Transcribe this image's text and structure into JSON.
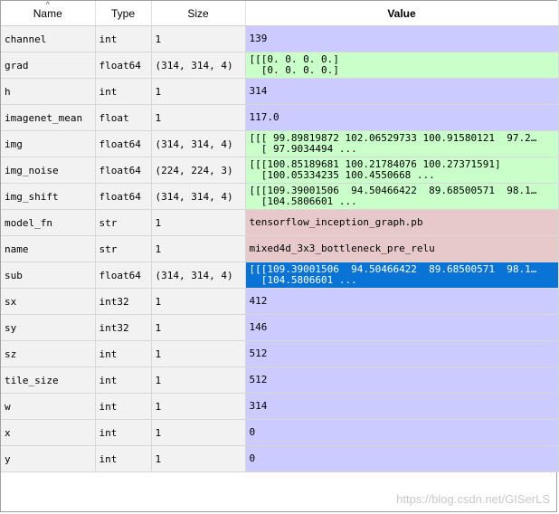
{
  "header": {
    "sort_indicator": "^",
    "name": "Name",
    "type": "Type",
    "size": "Size",
    "value": "Value"
  },
  "colors": {
    "numeric": "#cbcbff",
    "array": "#c9ffc9",
    "string": "#e8c9c9",
    "selected": "#0a74d6"
  },
  "rows": [
    {
      "name": "channel",
      "type": "int",
      "size": "1",
      "value": "139",
      "color": "#cbcbff",
      "selected": false
    },
    {
      "name": "grad",
      "type": "float64",
      "size": "(314, 314, 4)",
      "value": "[[[0. 0. 0. 0.]\n  [0. 0. 0. 0.]",
      "color": "#c9ffc9",
      "selected": false
    },
    {
      "name": "h",
      "type": "int",
      "size": "1",
      "value": "314",
      "color": "#cbcbff",
      "selected": false
    },
    {
      "name": "imagenet_mean",
      "type": "float",
      "size": "1",
      "value": "117.0",
      "color": "#cbcbff",
      "selected": false
    },
    {
      "name": "img",
      "type": "float64",
      "size": "(314, 314, 4)",
      "value": "[[[ 99.89819872 102.06529733 100.91580121  97.2…\n  [ 97.9034494 ...",
      "color": "#c9ffc9",
      "selected": false
    },
    {
      "name": "img_noise",
      "type": "float64",
      "size": "(224, 224, 3)",
      "value": "[[[100.85189681 100.21784076 100.27371591]\n  [100.05334235 100.4550668 ...",
      "color": "#c9ffc9",
      "selected": false
    },
    {
      "name": "img_shift",
      "type": "float64",
      "size": "(314, 314, 4)",
      "value": "[[[109.39001506  94.50466422  89.68500571  98.1…\n  [104.5806601 ...",
      "color": "#c9ffc9",
      "selected": false
    },
    {
      "name": "model_fn",
      "type": "str",
      "size": "1",
      "value": "tensorflow_inception_graph.pb",
      "color": "#e8c9c9",
      "selected": false
    },
    {
      "name": "name",
      "type": "str",
      "size": "1",
      "value": "mixed4d_3x3_bottleneck_pre_relu",
      "color": "#e8c9c9",
      "selected": false
    },
    {
      "name": "sub",
      "type": "float64",
      "size": "(314, 314, 4)",
      "value": "[[[109.39001506  94.50466422  89.68500571  98.1…\n  [104.5806601 ...",
      "color": "#0a74d6",
      "selected": true
    },
    {
      "name": "sx",
      "type": "int32",
      "size": "1",
      "value": "412",
      "color": "#cbcbff",
      "selected": false
    },
    {
      "name": "sy",
      "type": "int32",
      "size": "1",
      "value": "146",
      "color": "#cbcbff",
      "selected": false
    },
    {
      "name": "sz",
      "type": "int",
      "size": "1",
      "value": "512",
      "color": "#cbcbff",
      "selected": false
    },
    {
      "name": "tile_size",
      "type": "int",
      "size": "1",
      "value": "512",
      "color": "#cbcbff",
      "selected": false
    },
    {
      "name": "w",
      "type": "int",
      "size": "1",
      "value": "314",
      "color": "#cbcbff",
      "selected": false
    },
    {
      "name": "x",
      "type": "int",
      "size": "1",
      "value": "0",
      "color": "#cbcbff",
      "selected": false
    },
    {
      "name": "y",
      "type": "int",
      "size": "1",
      "value": "0",
      "color": "#cbcbff",
      "selected": false
    }
  ],
  "watermark": "https://blog.csdn.net/GISerLS"
}
